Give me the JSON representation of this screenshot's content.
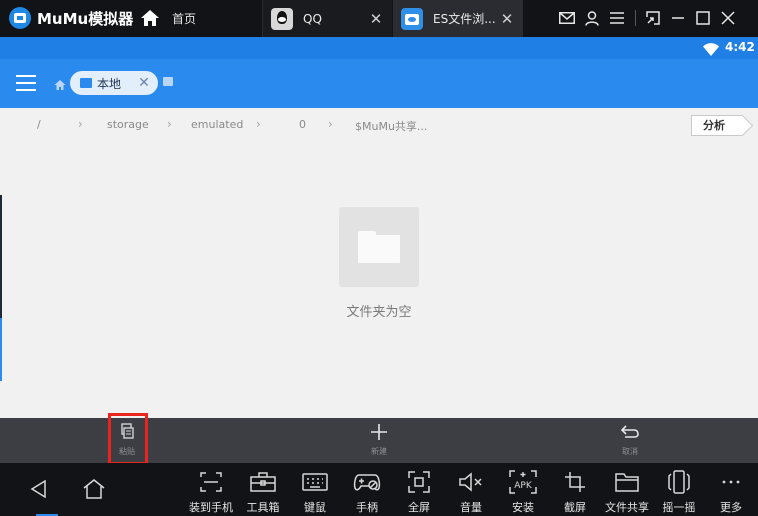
{
  "topbar": {
    "brand": "MuMu模拟器",
    "home_label": "首页",
    "tabs": [
      {
        "label": "QQ",
        "icon": "qq-icon"
      },
      {
        "label": "ES文件浏...",
        "icon": "es-file-explorer-icon"
      }
    ],
    "close_glyph": "✕"
  },
  "statusbar": {
    "time": "4:42"
  },
  "apptoolbar": {
    "chip_label": "本地",
    "chip_close": "✕"
  },
  "path": {
    "segments": [
      "/",
      "storage",
      "emulated",
      "0",
      "$MuMu共享..."
    ],
    "analyze_label": "分析"
  },
  "content": {
    "empty_text": "文件夹为空"
  },
  "actionbar": {
    "paste": "粘贴",
    "new": "新建",
    "cancel": "取消"
  },
  "bottombar": {
    "tools": [
      {
        "label": "装到手机",
        "icon": "install-to-phone-icon"
      },
      {
        "label": "工具箱",
        "icon": "toolbox-icon"
      },
      {
        "label": "键鼠",
        "icon": "keyboard-mouse-icon"
      },
      {
        "label": "手柄",
        "icon": "gamepad-icon"
      },
      {
        "label": "全屏",
        "icon": "fullscreen-icon"
      },
      {
        "label": "音量",
        "icon": "volume-icon"
      },
      {
        "label": "安装",
        "icon": "apk-install-icon"
      },
      {
        "label": "截屏",
        "icon": "screenshot-icon"
      },
      {
        "label": "文件共享",
        "icon": "file-share-icon"
      },
      {
        "label": "摇一摇",
        "icon": "shake-icon"
      },
      {
        "label": "更多",
        "icon": "more-icon"
      }
    ]
  },
  "colors": {
    "accent": "#2b8aed",
    "statusbar": "#1f7fe5",
    "highlight": "#e8261e"
  }
}
